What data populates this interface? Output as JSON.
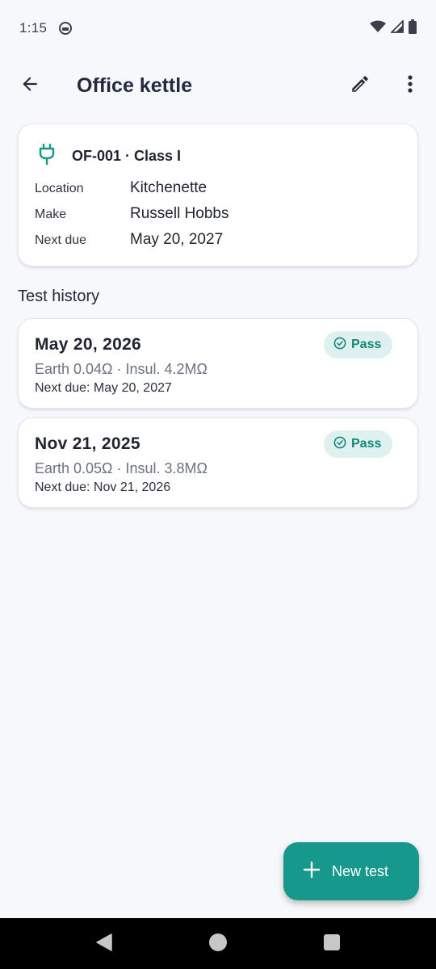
{
  "status_bar": {
    "time": "1:15"
  },
  "header": {
    "title": "Office kettle"
  },
  "asset": {
    "id_class": "OF-001 · Class I",
    "fields": [
      {
        "label": "Location",
        "value": "Kitchenette"
      },
      {
        "label": "Make",
        "value": "Russell Hobbs"
      },
      {
        "label": "Next due",
        "value": "May 20, 2027"
      }
    ]
  },
  "history": {
    "title": "Test history",
    "items": [
      {
        "date": "May 20, 2026",
        "measurements": "Earth 0.04Ω · Insul. 4.2MΩ",
        "next_due": "Next due: May 20, 2027",
        "result": "Pass"
      },
      {
        "date": "Nov 21, 2025",
        "measurements": "Earth 0.05Ω · Insul. 3.8MΩ",
        "next_due": "Next due: Nov 21, 2026",
        "result": "Pass"
      }
    ]
  },
  "fab": {
    "label": "New test"
  },
  "icons": {
    "back": "arrow-back-icon",
    "edit": "pencil-icon",
    "more": "more-vert-icon",
    "asset": "plug-icon",
    "pass": "check-circle-icon",
    "fab": "plus-icon"
  },
  "colors": {
    "accent": "#16998c",
    "pass_text": "#15857a",
    "pass_bg": "#dff1ef",
    "background": "#f6f8fb"
  }
}
